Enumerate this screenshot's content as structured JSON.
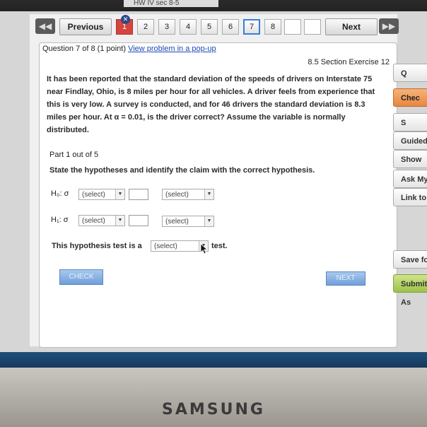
{
  "window": {
    "title": "HW IV sec 8-5"
  },
  "nav": {
    "previous_label": "Previous",
    "next_label": "Next",
    "question_numbers": [
      "1",
      "2",
      "3",
      "4",
      "5",
      "6",
      "7",
      "8"
    ],
    "badge_text": "✕"
  },
  "question": {
    "header": "Question 7 of 8 (1 point)",
    "popup_link": "View problem in a pop-up",
    "section": "8.5 Section Exercise 12",
    "problem_text": "It has been reported that the standard deviation of the speeds of drivers on Interstate 75 near Findlay, Ohio, is 8 miles per hour for all vehicles. A driver feels from experience that this is very low. A survey is conducted, and for 46 drivers the standard deviation is 8.3 miles per hour. At α = 0.01, is the driver correct? Assume the variable is normally distributed."
  },
  "part": {
    "label": "Part 1 out of 5",
    "instruction": "State the hypotheses and identify the claim with the correct hypothesis."
  },
  "h0": {
    "label": "H₀: σ",
    "select1": "(select)",
    "select2": "(select)"
  },
  "h1": {
    "label": "H₁: σ",
    "select1": "(select)",
    "select2": "(select)"
  },
  "test": {
    "prefix": "This hypothesis test is a",
    "select": "(select)",
    "suffix": "test."
  },
  "buttons": {
    "check": "CHECK",
    "next": "NEXT"
  },
  "sidebar": {
    "q": "Q",
    "check": "Chec",
    "s": "S",
    "guided": "Guided",
    "show": "Show",
    "ask": "Ask My",
    "link": "Link to",
    "save": "Save fo",
    "submit": "Submit As"
  },
  "device": {
    "brand": "SAMSUNG"
  }
}
